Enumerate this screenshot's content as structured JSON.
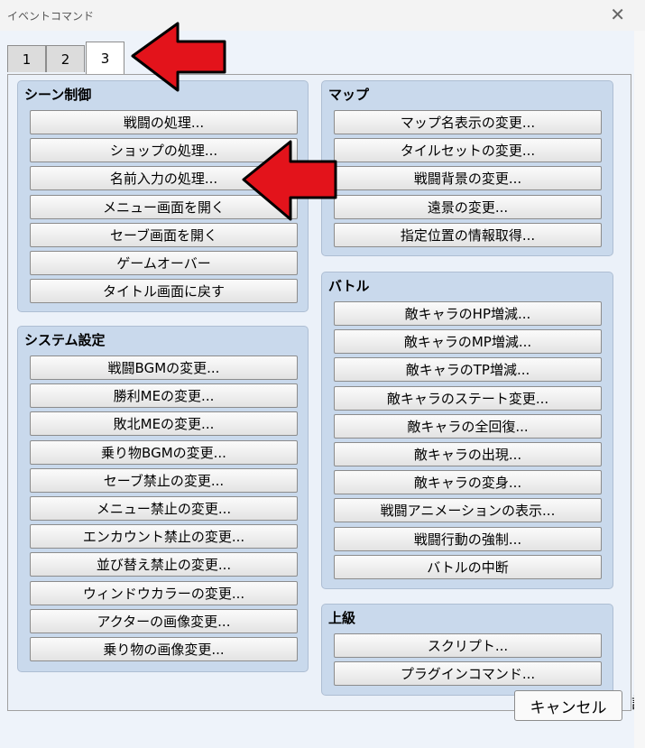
{
  "window": {
    "title": "イベントコマンド",
    "close_glyph": "✕"
  },
  "tabs": [
    "1",
    "2",
    "3"
  ],
  "active_tab": "3",
  "groups": {
    "scene": {
      "title": "シーン制御",
      "buttons": [
        "戦闘の処理...",
        "ショップの処理...",
        "名前入力の処理...",
        "メニュー画面を開く",
        "セーブ画面を開く",
        "ゲームオーバー",
        "タイトル画面に戻す"
      ]
    },
    "system": {
      "title": "システム設定",
      "buttons": [
        "戦闘BGMの変更...",
        "勝利MEの変更...",
        "敗北MEの変更...",
        "乗り物BGMの変更...",
        "セーブ禁止の変更...",
        "メニュー禁止の変更...",
        "エンカウント禁止の変更...",
        "並び替え禁止の変更...",
        "ウィンドウカラーの変更...",
        "アクターの画像変更...",
        "乗り物の画像変更..."
      ]
    },
    "map": {
      "title": "マップ",
      "buttons": [
        "マップ名表示の変更...",
        "タイルセットの変更...",
        "戦闘背景の変更...",
        "遠景の変更...",
        "指定位置の情報取得..."
      ]
    },
    "battle": {
      "title": "バトル",
      "buttons": [
        "敵キャラのHP増減...",
        "敵キャラのMP増減...",
        "敵キャラのTP増減...",
        "敵キャラのステート変更...",
        "敵キャラの全回復...",
        "敵キャラの出現...",
        "敵キャラの変身...",
        "戦闘アニメーションの表示...",
        "戦闘行動の強制...",
        "バトルの中断"
      ]
    },
    "advanced": {
      "title": "上級",
      "buttons": [
        "スクリプト...",
        "プラグインコマンド..."
      ]
    }
  },
  "footer": {
    "cancel_label": "キャンセル",
    "ok_partial": "設"
  },
  "annotation_color": "#e3131b"
}
